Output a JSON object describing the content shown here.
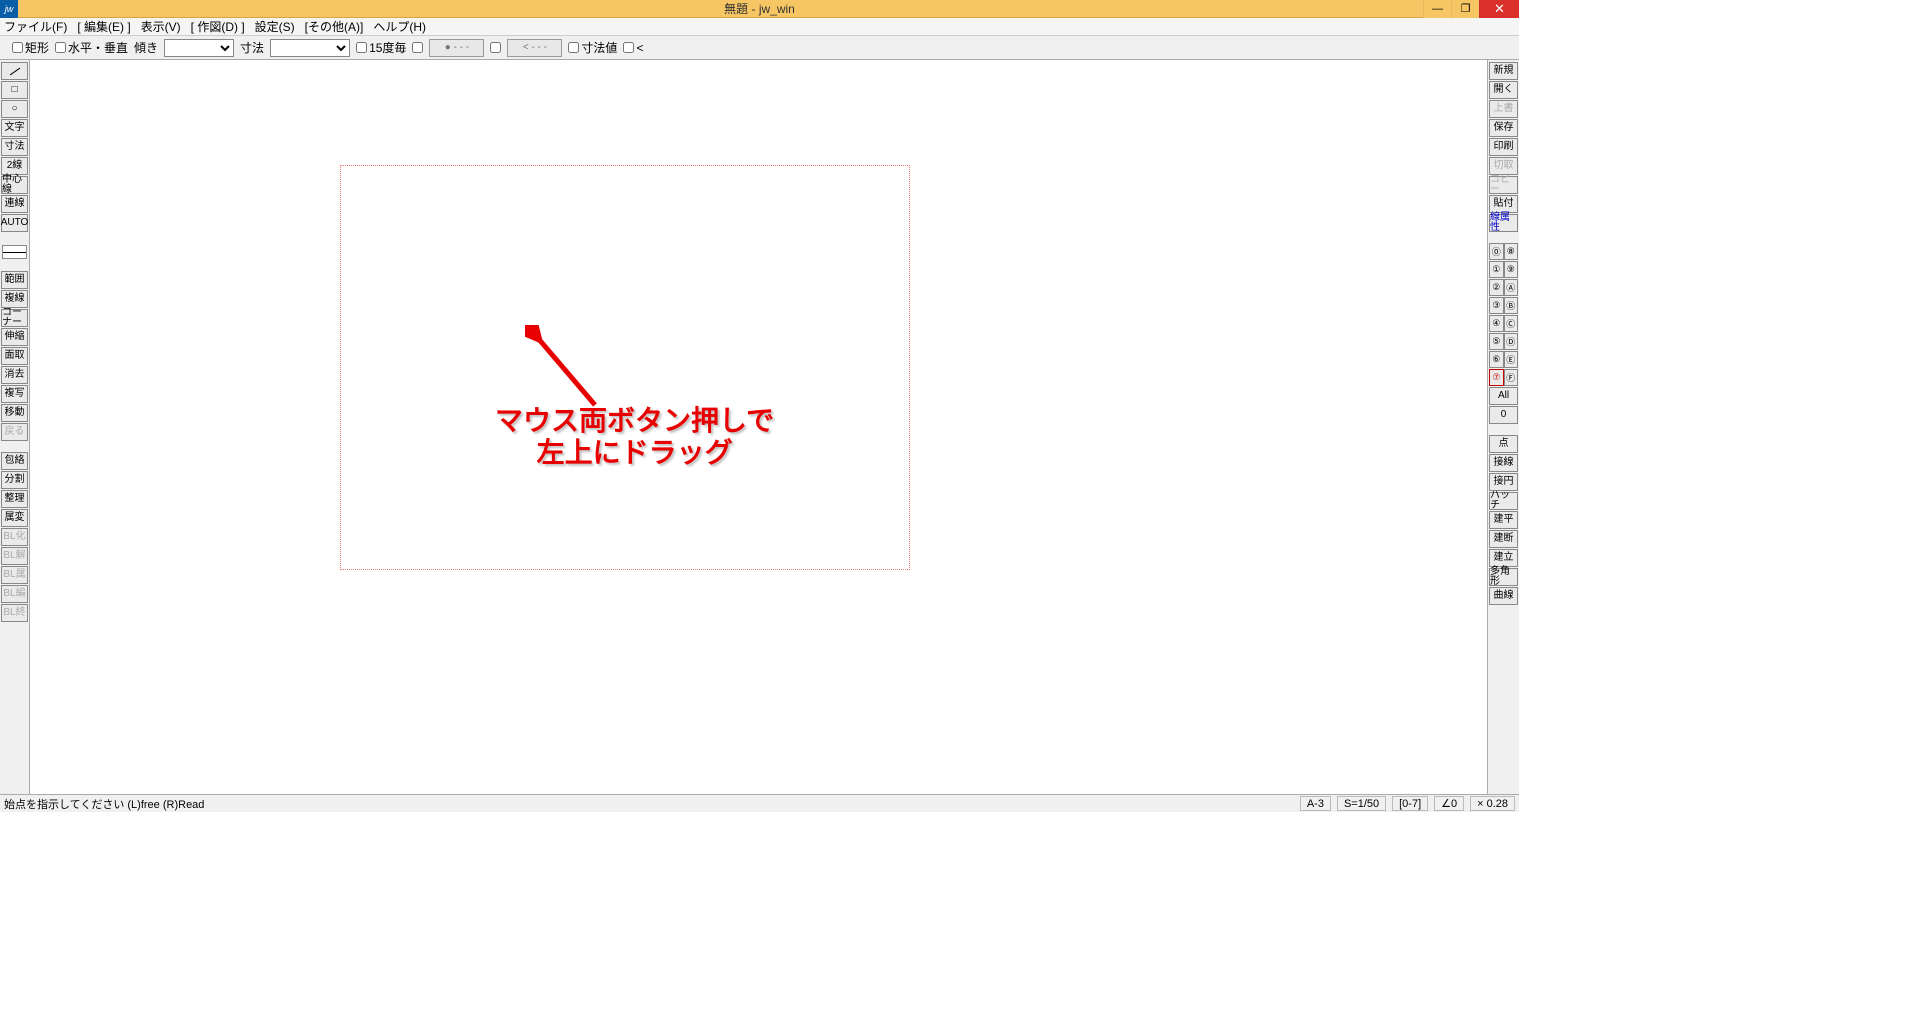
{
  "title": "無題 - jw_win",
  "menu": [
    "ファイル(F)",
    "[ 編集(E) ]",
    "表示(V)",
    "[ 作図(D) ]",
    "設定(S)",
    "[その他(A)]",
    "ヘルプ(H)"
  ],
  "options": {
    "rect": "矩形",
    "hv": "水平・垂直",
    "tilt": "傾き",
    "dim": "寸法",
    "deg15": "15度毎",
    "btn1": "● - - -",
    "btn2": "< - - -",
    "dimval": "寸法値",
    "lt": "<"
  },
  "left_tools": [
    "",
    "□",
    "○",
    "文字",
    "寸法",
    "2線",
    "中心線",
    "連線",
    "AUTO"
  ],
  "left_tools2": [
    "範囲",
    "複線",
    "コーナー",
    "伸縮",
    "面取",
    "消去",
    "複写",
    "移動",
    "戻る"
  ],
  "left_tools3": [
    "包絡",
    "分割",
    "整理",
    "属変",
    "BL化",
    "BL解",
    "BL属",
    "BL編",
    "BL終"
  ],
  "right_tools": [
    "新規",
    "開く",
    "上書",
    "保存",
    "印刷",
    "切取",
    "コピー",
    "貼付",
    "線属性"
  ],
  "layer_pairs": [
    [
      "⓪",
      "⑧"
    ],
    [
      "①",
      "⑨"
    ],
    [
      "②",
      "Ⓐ"
    ],
    [
      "③",
      "Ⓑ"
    ],
    [
      "④",
      "Ⓒ"
    ],
    [
      "⑤",
      "Ⓓ"
    ],
    [
      "⑥",
      "Ⓔ"
    ],
    [
      "⑦",
      "Ⓕ"
    ]
  ],
  "right_mid": [
    "All",
    "0"
  ],
  "right_bottom": [
    "点",
    "接線",
    "接円",
    "ハッチ",
    "建平",
    "建断",
    "建立",
    "多角形",
    "曲線"
  ],
  "annotation_l1": "マウス両ボタン押しで",
  "annotation_l2": "左上にドラッグ",
  "status_left": "始点を指示してください (L)free (R)Read",
  "status_right": [
    "A-3",
    "S=1/50",
    "[0-7]",
    "∠0",
    "× 0.28"
  ]
}
